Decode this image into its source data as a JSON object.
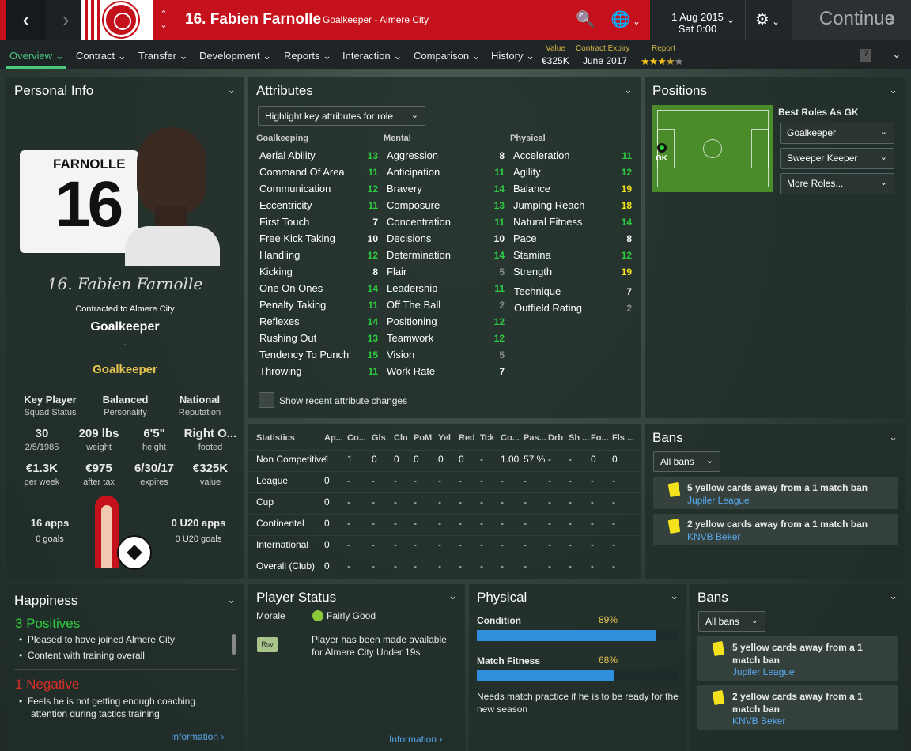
{
  "topbar": {
    "player_title": "16. Fabien Farnolle",
    "subtitle": "Goalkeeper - Almere City",
    "date": "1 Aug 2015",
    "time": "Sat 0:00",
    "continue_label": "Continue"
  },
  "menu": {
    "items": [
      "Overview",
      "Contract",
      "Transfer",
      "Development",
      "Reports",
      "Interaction",
      "Comparison",
      "History"
    ],
    "value_label": "Value",
    "value": "€325K",
    "contract_label": "Contract Expiry",
    "contract": "June 2017",
    "report_label": "Report",
    "report_stars": 3.5
  },
  "personal": {
    "header": "Personal Info",
    "shirt_name": "FARNOLLE",
    "shirt_number": "16",
    "signature": "16. Fabien Farnolle",
    "contracted": "Contracted to Almere City",
    "position": "Goalkeeper",
    "dash": "-",
    "role": "Goalkeeper",
    "stats1": [
      {
        "value": "Key Player",
        "label": "Squad Status"
      },
      {
        "value": "Balanced",
        "label": "Personality"
      },
      {
        "value": "National",
        "label": "Reputation"
      }
    ],
    "stats2": [
      {
        "value": "30",
        "label": "2/5/1985"
      },
      {
        "value": "209 lbs",
        "label": "weight"
      },
      {
        "value": "6'5\"",
        "label": "height"
      },
      {
        "value": "Right O...",
        "label": "footed"
      }
    ],
    "stats3": [
      {
        "value": "€1.3K",
        "label": "per week"
      },
      {
        "value": "€975",
        "label": "after tax"
      },
      {
        "value": "6/30/17",
        "label": "expires"
      },
      {
        "value": "€325K",
        "label": "value"
      }
    ],
    "apps": "16 apps",
    "goals": "0 goals",
    "u20_apps": "0 U20 apps",
    "u20_goals": "0 U20 goals"
  },
  "attributes": {
    "header": "Attributes",
    "highlight_label": "Highlight key attributes for role",
    "goalkeeping_header": "Goalkeeping",
    "mental_header": "Mental",
    "physical_header": "Physical",
    "goalkeeping": [
      {
        "name": "Aerial Ability",
        "value": "13"
      },
      {
        "name": "Command Of Area",
        "value": "11"
      },
      {
        "name": "Communication",
        "value": "12"
      },
      {
        "name": "Eccentricity",
        "value": "11"
      },
      {
        "name": "First Touch",
        "value": "7"
      },
      {
        "name": "Free Kick Taking",
        "value": "10"
      },
      {
        "name": "Handling",
        "value": "12"
      },
      {
        "name": "Kicking",
        "value": "8"
      },
      {
        "name": "One On Ones",
        "value": "14"
      },
      {
        "name": "Penalty Taking",
        "value": "11"
      },
      {
        "name": "Reflexes",
        "value": "14"
      },
      {
        "name": "Rushing Out",
        "value": "13"
      },
      {
        "name": "Tendency To Punch",
        "value": "15"
      },
      {
        "name": "Throwing",
        "value": "11"
      }
    ],
    "mental": [
      {
        "name": "Aggression",
        "value": "8"
      },
      {
        "name": "Anticipation",
        "value": "11"
      },
      {
        "name": "Bravery",
        "value": "14"
      },
      {
        "name": "Composure",
        "value": "13"
      },
      {
        "name": "Concentration",
        "value": "11"
      },
      {
        "name": "Decisions",
        "value": "10"
      },
      {
        "name": "Determination",
        "value": "14"
      },
      {
        "name": "Flair",
        "value": "5"
      },
      {
        "name": "Leadership",
        "value": "11"
      },
      {
        "name": "Off The Ball",
        "value": "2"
      },
      {
        "name": "Positioning",
        "value": "12"
      },
      {
        "name": "Teamwork",
        "value": "12"
      },
      {
        "name": "Vision",
        "value": "5"
      },
      {
        "name": "Work Rate",
        "value": "7"
      }
    ],
    "physical": [
      {
        "name": "Acceleration",
        "value": "11"
      },
      {
        "name": "Agility",
        "value": "12"
      },
      {
        "name": "Balance",
        "value": "19"
      },
      {
        "name": "Jumping Reach",
        "value": "18"
      },
      {
        "name": "Natural Fitness",
        "value": "14"
      },
      {
        "name": "Pace",
        "value": "8"
      },
      {
        "name": "Stamina",
        "value": "12"
      },
      {
        "name": "Strength",
        "value": "19"
      }
    ],
    "other": [
      {
        "name": "Technique",
        "value": "7"
      },
      {
        "name": "Outfield Rating",
        "value": "2"
      }
    ],
    "show_changes_label": "Show recent attribute changes"
  },
  "positions": {
    "header": "Positions",
    "best_roles_label": "Best Roles As GK",
    "gk_label": "GK",
    "roles": [
      "Goalkeeper",
      "Sweeper Keeper",
      "More Roles..."
    ]
  },
  "statistics": {
    "columns": [
      "Statistics",
      "Ap...",
      "Co...",
      "Gls",
      "Cln",
      "PoM",
      "Yel",
      "Red",
      "Tck",
      "Co...",
      "Pas...",
      "Drb",
      "Sh ...",
      "Fo...",
      "Fls ..."
    ],
    "rows": [
      [
        "Non Competitive",
        "1",
        "1",
        "0",
        "0",
        "0",
        "0",
        "0",
        "-",
        "1.00",
        "57 %",
        "-",
        "-",
        "0",
        "0"
      ],
      [
        "League",
        "0",
        "-",
        "-",
        "-",
        "-",
        "-",
        "-",
        "-",
        "-",
        "-",
        "-",
        "-",
        "-",
        "-"
      ],
      [
        "Cup",
        "0",
        "-",
        "-",
        "-",
        "-",
        "-",
        "-",
        "-",
        "-",
        "-",
        "-",
        "-",
        "-",
        "-"
      ],
      [
        "Continental",
        "0",
        "-",
        "-",
        "-",
        "-",
        "-",
        "-",
        "-",
        "-",
        "-",
        "-",
        "-",
        "-",
        "-"
      ],
      [
        "International",
        "0",
        "-",
        "-",
        "-",
        "-",
        "-",
        "-",
        "-",
        "-",
        "-",
        "-",
        "-",
        "-",
        "-"
      ],
      [
        "Overall (Club)",
        "0",
        "-",
        "-",
        "-",
        "-",
        "-",
        "-",
        "-",
        "-",
        "-",
        "-",
        "-",
        "-",
        "-"
      ]
    ]
  },
  "bans_top": {
    "header": "Bans",
    "filter": "All bans",
    "items": [
      {
        "text": "5 yellow cards away from a 1 match ban",
        "competition": "Jupiler League"
      },
      {
        "text": "2 yellow cards away from a 1 match ban",
        "competition": "KNVB Beker"
      }
    ]
  },
  "happiness": {
    "header": "Happiness",
    "positives_title": "3 Positives",
    "positives": [
      "Pleased to have joined Almere City",
      "Content with training overall"
    ],
    "negatives_title": "1 Negative",
    "negatives": [
      "Feels he is not getting enough coaching attention during tactics training"
    ],
    "info_link": "Information"
  },
  "player_status": {
    "header": "Player Status",
    "morale_label": "Morale",
    "morale_value": "Fairly Good",
    "badge": "Rsv",
    "status_text": "Player has been made available for Almere City Under 19s",
    "info_link": "Information"
  },
  "physical": {
    "header": "Physical",
    "condition_label": "Condition",
    "condition_value": "89%",
    "condition_fraction": 0.89,
    "fitness_label": "Match Fitness",
    "fitness_value": "68%",
    "fitness_fraction": 0.68,
    "note": "Needs match practice if he is to be ready for the new season"
  },
  "bans_bottom": {
    "header": "Bans",
    "filter": "All bans",
    "items": [
      {
        "text": "5 yellow cards away from a 1 match ban",
        "competition": "Jupiler League"
      },
      {
        "text": "2 yellow cards away from a 1 match ban",
        "competition": "KNVB Beker"
      }
    ]
  },
  "colors": {
    "accent": "#c4111b",
    "green": "#4cc87d",
    "gold": "#e8c453",
    "bar": "#2f8fdc"
  }
}
